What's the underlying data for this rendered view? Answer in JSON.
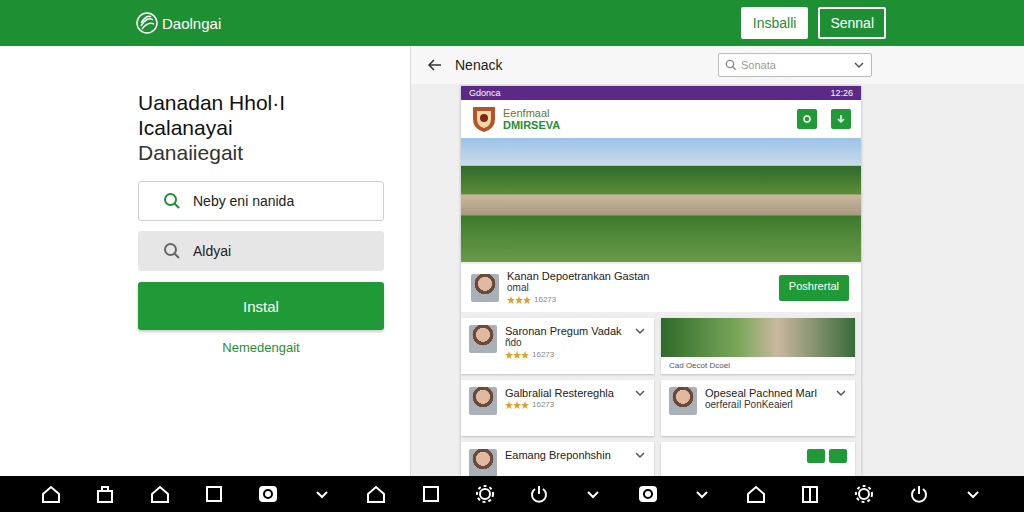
{
  "header": {
    "logo": "Daolngai",
    "buttons": [
      {
        "label": "Insballi",
        "kind": "filled"
      },
      {
        "label": "Sennal",
        "kind": "outline"
      }
    ]
  },
  "left": {
    "title": [
      "Uanadan Hhol·I Icalanayai",
      "Danaiiegait"
    ],
    "fields": [
      {
        "value": "Neby eni nanida",
        "kind": "outlined"
      },
      {
        "value": "Aldyai",
        "kind": "filled"
      }
    ],
    "install_button": "Instal",
    "link": "Nemedengait"
  },
  "toolbar": {
    "title": "Nenack",
    "search": {
      "placeholder": "Sonata"
    }
  },
  "phone": {
    "status": {
      "left": "Gdonca",
      "right": "12:26"
    },
    "app_header": {
      "title": "Eenfmaal",
      "subtitle": "DMIRSEVA"
    },
    "featured": {
      "title": "Kanan Depoetrankan Gastan",
      "subtitle": "omal",
      "stars": 3,
      "count": "16273",
      "button": "Poshrertal"
    },
    "cards": [
      {
        "kind": "profile",
        "title": "Saronan Pregum Vadak",
        "subtitle": "ñdo",
        "stars": 3,
        "count": "16273"
      },
      {
        "kind": "photo",
        "caption": "Cad Oecot Dcoel"
      },
      {
        "kind": "profile",
        "title": "Galbralial Restereghla",
        "subtitle": "",
        "stars": 3,
        "count": "16273"
      },
      {
        "kind": "profile",
        "title": "Opeseal Pachned Marl",
        "subtitle": "oerferail PonKeaierl",
        "stars": 0,
        "count": ""
      },
      {
        "kind": "profile",
        "title": "Eamang Breponhshin",
        "subtitle": "",
        "stars": 0,
        "count": ""
      },
      {
        "kind": "actions"
      }
    ]
  }
}
